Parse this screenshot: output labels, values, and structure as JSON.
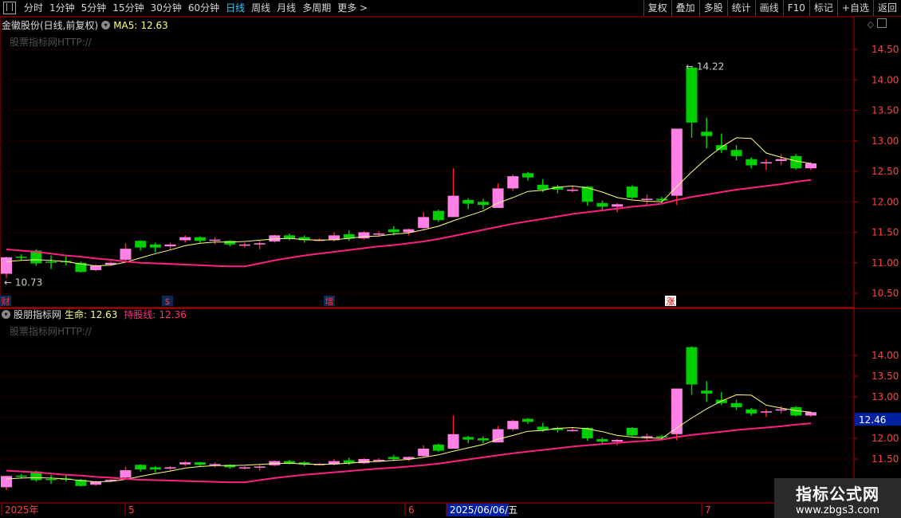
{
  "toolbar": {
    "left": [
      "分时",
      "1分钟",
      "5分钟",
      "15分钟",
      "30分钟",
      "60分钟",
      "日线",
      "周线",
      "月线",
      "多周期",
      "更多 >"
    ],
    "active": "日线",
    "right": [
      "复权",
      "叠加",
      "多股",
      "统计",
      "画线",
      "F10",
      "标记",
      "+自选",
      "返回"
    ]
  },
  "upper": {
    "title": "金徽股份(日线,前复权)",
    "ma_label": "MA5:",
    "ma_value": "12.63",
    "watermark": "股票指标网HTTP://",
    "high_label": "14.22",
    "low_label": "10.73",
    "markers": [
      "财",
      "$",
      "增",
      "涨"
    ],
    "yticks": [
      10.5,
      11.0,
      11.5,
      12.0,
      12.5,
      13.0,
      13.5,
      14.0,
      14.5
    ]
  },
  "lower": {
    "title": "股朋指标网",
    "life_label": "生命:",
    "life_value": "12.63",
    "hold_label": "持股线:",
    "hold_value": "12.36",
    "watermark": "股票指标网HTTP://",
    "current_value": "12.46",
    "yticks": [
      11.5,
      12.0,
      12.5,
      13.0,
      13.5,
      14.0
    ]
  },
  "xaxis": {
    "labels": [
      "2025年",
      "5",
      "6",
      "2025/06/06/五",
      "7"
    ]
  },
  "badge": {
    "title": "指标公式网",
    "url": "www.zbgs3.com"
  },
  "colors": {
    "up": "#ff80e6",
    "down": "#00d000",
    "ma": "#ffff80",
    "hold": "#ff2080",
    "axis": "#c00000",
    "text": "#ff4040"
  },
  "chart_data": {
    "type": "candlestick",
    "candles": [
      [
        10.82,
        11.09,
        11.1,
        10.75
      ],
      [
        11.1,
        11.08,
        11.14,
        11.04
      ],
      [
        11.2,
        10.99,
        11.22,
        10.95
      ],
      [
        11.02,
        11.0,
        11.12,
        10.9
      ],
      [
        11.03,
        11.02,
        11.1,
        10.96
      ],
      [
        11.0,
        10.85,
        11.02,
        10.84
      ],
      [
        10.88,
        10.95,
        10.98,
        10.86
      ],
      [
        10.97,
        11.0,
        11.02,
        10.95
      ],
      [
        11.05,
        11.23,
        11.32,
        11.03
      ],
      [
        11.36,
        11.25,
        11.37,
        11.2
      ],
      [
        11.3,
        11.25,
        11.33,
        11.17
      ],
      [
        11.27,
        11.3,
        11.33,
        11.22
      ],
      [
        11.37,
        11.42,
        11.45,
        11.33
      ],
      [
        11.42,
        11.36,
        11.43,
        11.33
      ],
      [
        11.38,
        11.38,
        11.42,
        11.3
      ],
      [
        11.36,
        11.3,
        11.37,
        11.27
      ],
      [
        11.28,
        11.3,
        11.33,
        11.25
      ],
      [
        11.3,
        11.32,
        11.36,
        11.22
      ],
      [
        11.35,
        11.45,
        11.46,
        11.33
      ],
      [
        11.45,
        11.4,
        11.48,
        11.37
      ],
      [
        11.42,
        11.37,
        11.45,
        11.33
      ],
      [
        11.36,
        11.38,
        11.4,
        11.35
      ],
      [
        11.37,
        11.45,
        11.5,
        11.35
      ],
      [
        11.47,
        11.4,
        11.53,
        11.36
      ],
      [
        11.4,
        11.5,
        11.52,
        11.38
      ],
      [
        11.48,
        11.48,
        11.52,
        11.43
      ],
      [
        11.55,
        11.5,
        11.6,
        11.45
      ],
      [
        11.5,
        11.55,
        11.56,
        11.45
      ],
      [
        11.57,
        11.75,
        11.83,
        11.55
      ],
      [
        11.85,
        11.7,
        11.87,
        11.67
      ],
      [
        11.75,
        12.1,
        12.55,
        11.75
      ],
      [
        12.03,
        11.97,
        12.06,
        11.88
      ],
      [
        12.0,
        11.95,
        12.05,
        11.88
      ],
      [
        11.9,
        12.22,
        12.3,
        11.9
      ],
      [
        12.22,
        12.42,
        12.45,
        12.18
      ],
      [
        12.47,
        12.4,
        12.49,
        12.35
      ],
      [
        12.28,
        12.2,
        12.37,
        12.16
      ],
      [
        12.25,
        12.2,
        12.28,
        12.14
      ],
      [
        12.18,
        12.2,
        12.25,
        12.16
      ],
      [
        12.25,
        12.0,
        12.26,
        11.94
      ],
      [
        11.98,
        11.92,
        12.02,
        11.86
      ],
      [
        11.92,
        11.96,
        11.98,
        11.83
      ],
      [
        12.25,
        12.07,
        12.27,
        12.05
      ],
      [
        12.05,
        12.05,
        12.12,
        11.95
      ],
      [
        12.05,
        12.02,
        12.08,
        11.96
      ],
      [
        12.1,
        13.2,
        13.2,
        11.95
      ],
      [
        14.2,
        13.3,
        14.22,
        13.05
      ],
      [
        13.15,
        13.08,
        13.38,
        12.88
      ],
      [
        12.93,
        12.85,
        13.12,
        12.8
      ],
      [
        12.85,
        12.75,
        12.93,
        12.68
      ],
      [
        12.7,
        12.6,
        12.73,
        12.55
      ],
      [
        12.63,
        12.65,
        12.7,
        12.52
      ],
      [
        12.67,
        12.7,
        12.78,
        12.6
      ],
      [
        12.75,
        12.55,
        12.78,
        12.53
      ],
      [
        12.55,
        12.63,
        12.65,
        12.52
      ]
    ],
    "ma5": [
      11.02,
      11.04,
      11.05,
      11.04,
      11.02,
      10.98,
      10.95,
      10.96,
      11.01,
      11.08,
      11.15,
      11.21,
      11.28,
      11.32,
      11.34,
      11.34,
      11.35,
      11.37,
      11.39,
      11.4,
      11.38,
      11.37,
      11.38,
      11.4,
      11.43,
      11.44,
      11.47,
      11.49,
      11.54,
      11.6,
      11.69,
      11.77,
      11.85,
      11.98,
      12.07,
      12.17,
      12.19,
      12.24,
      12.26,
      12.23,
      12.16,
      12.07,
      12.03,
      12.01,
      12.0,
      12.25,
      12.49,
      12.71,
      12.9,
      13.05,
      13.04,
      12.8,
      12.73,
      12.67,
      12.63
    ],
    "hold": [
      11.22,
      11.2,
      11.18,
      11.15,
      11.12,
      11.1,
      11.07,
      11.05,
      11.02,
      11.0,
      10.99,
      10.98,
      10.97,
      10.96,
      10.95,
      10.94,
      10.94,
      10.99,
      11.04,
      11.08,
      11.12,
      11.15,
      11.18,
      11.21,
      11.24,
      11.27,
      11.29,
      11.32,
      11.35,
      11.39,
      11.44,
      11.49,
      11.54,
      11.59,
      11.64,
      11.68,
      11.72,
      11.76,
      11.8,
      11.83,
      11.86,
      11.89,
      11.92,
      11.94,
      11.97,
      12.03,
      12.08,
      12.12,
      12.16,
      12.2,
      12.23,
      12.26,
      12.29,
      12.33,
      12.36
    ]
  }
}
